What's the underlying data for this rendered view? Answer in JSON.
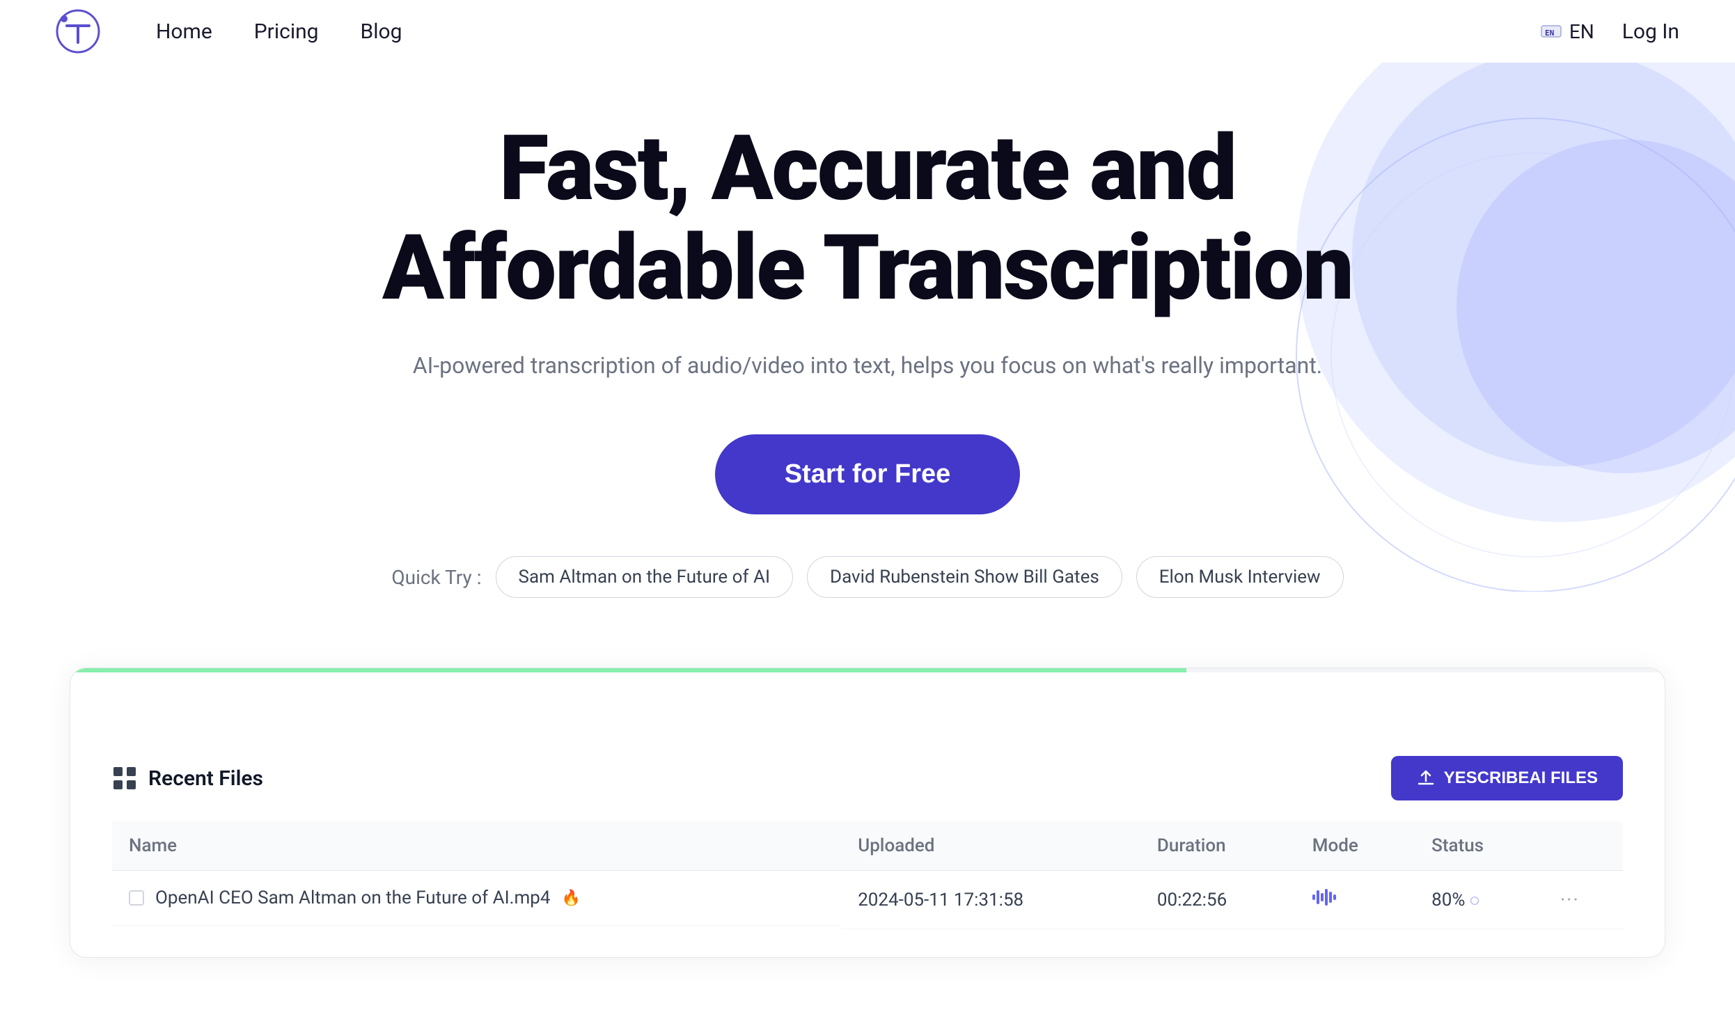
{
  "navbar": {
    "links": [
      {
        "label": "Home",
        "id": "home"
      },
      {
        "label": "Pricing",
        "id": "pricing"
      },
      {
        "label": "Blog",
        "id": "blog"
      }
    ],
    "lang": "EN",
    "login": "Log In"
  },
  "hero": {
    "title": "Fast, Accurate and Affordable Transcription",
    "subtitle": "AI-powered transcription of audio/video into text, helps you focus on what's really important.",
    "cta": "Start for Free",
    "quick_try_label": "Quick Try :",
    "quick_try_chips": [
      "Sam Altman on the Future of AI",
      "David Rubenstein Show Bill Gates",
      "Elon Musk Interview"
    ]
  },
  "dashboard": {
    "recent_files_label": "Recent Files",
    "upload_button": "YESCRIBEAI FILES",
    "table_headers": [
      "Name",
      "Uploaded",
      "Duration",
      "Mode",
      "Status"
    ],
    "rows": [
      {
        "name": "OpenAI CEO Sam Altman on the Future of AI.mp4",
        "uploaded": "2024-05-11 17:31:58",
        "duration": "00:22:56",
        "mode": "audio-wave",
        "status": "80%"
      }
    ]
  },
  "icons": {
    "logo": "T",
    "lang_icon": "🌐",
    "upload_icon": "↑",
    "grid_icon": "⊞",
    "file_icon": "🔥"
  }
}
